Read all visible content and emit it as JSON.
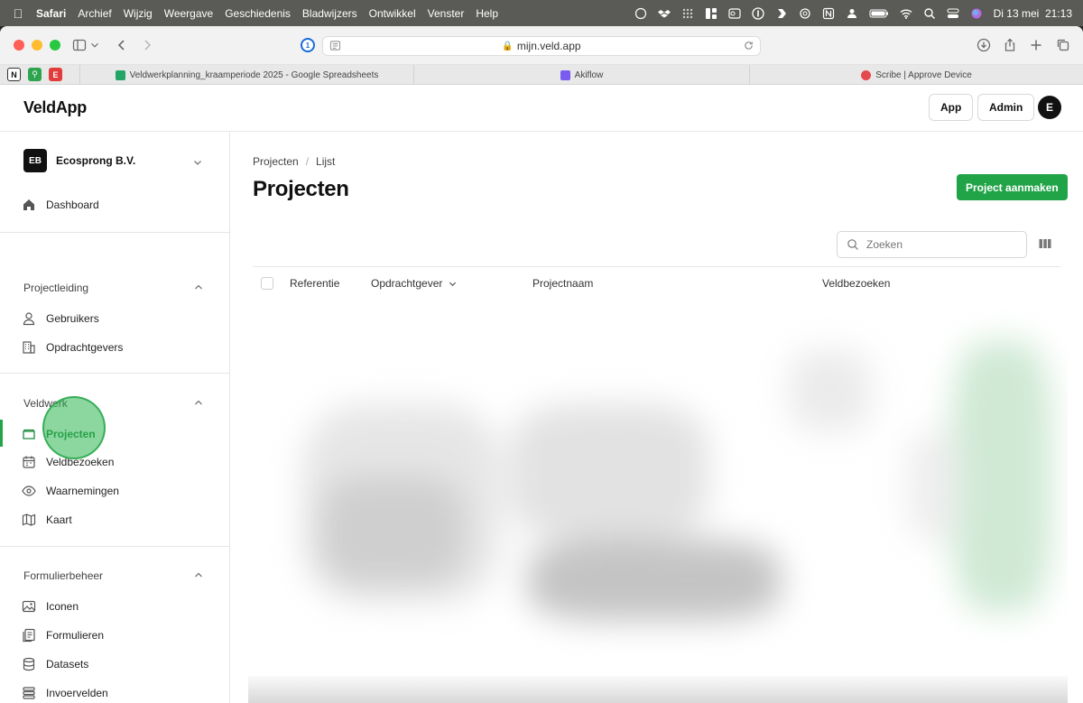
{
  "menubar": {
    "items": [
      "Safari",
      "Archief",
      "Wijzig",
      "Weergave",
      "Geschiedenis",
      "Bladwijzers",
      "Ontwikkel",
      "Venster",
      "Help"
    ],
    "datetime": "Di 13 mei  21:13"
  },
  "browser": {
    "url": "mijn.veld.app",
    "tabs": [
      {
        "title": "Veldwerkplanning_kraamperiode 2025 - Google Spreadsheets",
        "favicon_color": "#23a566"
      },
      {
        "title": "Akiflow",
        "favicon_color": "#7b5cf0"
      },
      {
        "title": "Scribe | Approve Device",
        "favicon_color": "#e5484d"
      }
    ]
  },
  "header": {
    "logo": "VeldApp",
    "app_button": "App",
    "admin_button": "Admin",
    "avatar_initial": "E"
  },
  "sidebar": {
    "org_initials": "EB",
    "org_name": "Ecosprong B.V.",
    "dashboard": "Dashboard",
    "sections": [
      {
        "title": "Projectleiding",
        "items": [
          "Gebruikers",
          "Opdrachtgevers"
        ]
      },
      {
        "title": "Veldwerk",
        "items": [
          "Projecten",
          "Veldbezoeken",
          "Waarnemingen",
          "Kaart"
        ]
      },
      {
        "title": "Formulierbeheer",
        "items": [
          "Iconen",
          "Formulieren",
          "Datasets",
          "Invoervelden"
        ]
      }
    ],
    "active_item": "Projecten"
  },
  "main": {
    "breadcrumb": [
      "Projecten",
      "Lijst"
    ],
    "title": "Projecten",
    "create_button": "Project aanmaken",
    "search_placeholder": "Zoeken",
    "columns": [
      "Referentie",
      "Opdrachtgever",
      "Projectnaam",
      "Veldbezoeken"
    ]
  },
  "colors": {
    "accent": "#21a348"
  }
}
